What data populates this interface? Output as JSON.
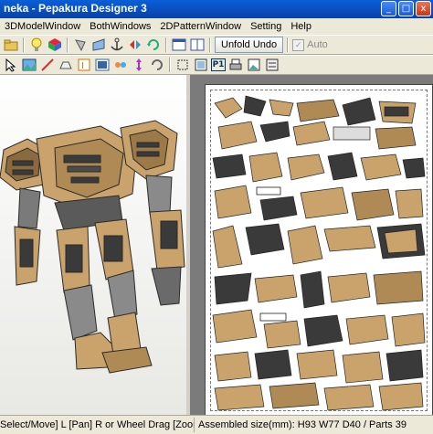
{
  "window": {
    "title": "neka - Pepakura Designer 3",
    "minimize": "_",
    "maximize": "□",
    "close": "x"
  },
  "menu": [
    {
      "label": "3DModelWindow"
    },
    {
      "label": "BothWindows"
    },
    {
      "label": "2DPatternWindow"
    },
    {
      "label": "Setting"
    },
    {
      "label": "Help"
    }
  ],
  "toolbar1": {
    "unfold_label": "Unfold Undo",
    "auto_label": "Auto",
    "auto_checked": true
  },
  "toolbar2": {
    "page_label": "P1"
  },
  "status": {
    "left": "Select/Move] L [Pan] R or Wheel Drag [Zoom] Shif",
    "right": "Assembled size(mm): H93 W77 D40 / Parts 39"
  },
  "colors": {
    "title_bar": "#0842a8",
    "chrome": "#ece9d8",
    "pattern_bg": "#7b7b7b",
    "armor_tan": "#c9a36b",
    "armor_dark": "#3a3a3a"
  }
}
